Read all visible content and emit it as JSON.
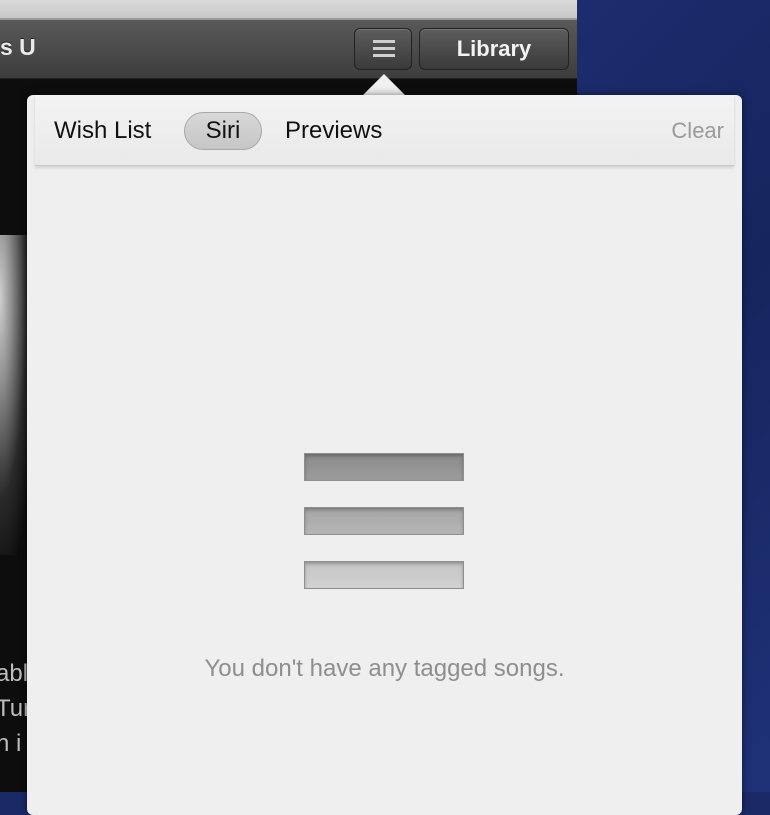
{
  "toolbar": {
    "title_fragment": "s U",
    "menu_icon": "list-menu-icon",
    "library_label": "Library"
  },
  "background_text": [
    "abl",
    "Tur",
    "n i"
  ],
  "popover": {
    "tabs": [
      {
        "label": "Wish List",
        "selected": false
      },
      {
        "label": "Siri",
        "selected": true
      },
      {
        "label": "Previews",
        "selected": false
      }
    ],
    "clear_label": "Clear",
    "empty_icon": "tagged-list-icon",
    "empty_message": "You don't have any tagged songs."
  },
  "colors": {
    "popover_bg": "#efefef",
    "toolbar_bg": "#4a4a4a",
    "desktop_bg": "#1c2c6e"
  }
}
